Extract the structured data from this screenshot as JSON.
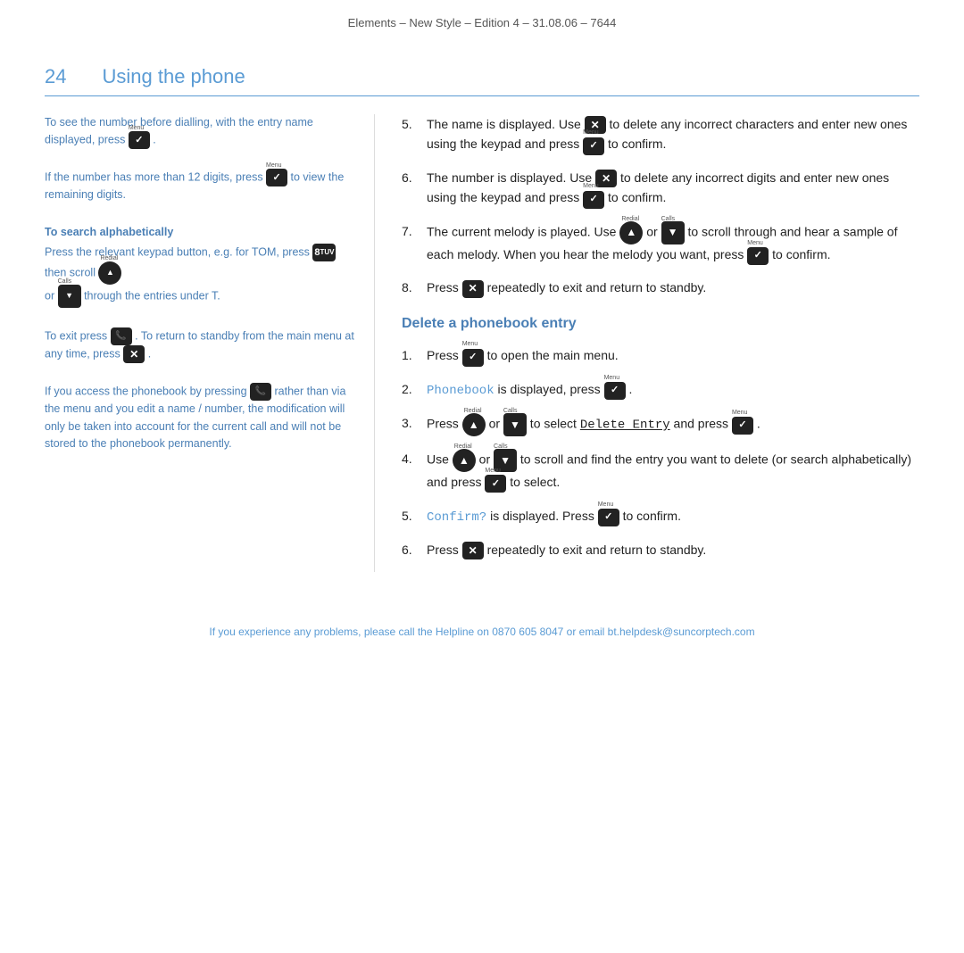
{
  "header": {
    "text": "Elements – New Style – Edition 4 – 31.08.06 – 7644"
  },
  "section": {
    "number": "24",
    "title": "Using the phone"
  },
  "left_column": {
    "block1": {
      "text": "To see the number before dialling, with the entry name displayed, press"
    },
    "block2": {
      "text": "If the number has more than 12 digits, press",
      "text2": "to view the remaining digits."
    },
    "block3": {
      "heading": "To search alphabetically",
      "text": "Press the relevant keypad button, e.g. for TOM, press",
      "text2": "then scroll",
      "text3": "or",
      "text4": "through the entries under T."
    },
    "block4": {
      "text": "To exit press",
      "text2": ". To return to standby from the main menu at any time, press"
    },
    "block5": {
      "text": "If you access the phonebook by pressing",
      "text2": "rather than via the menu and you edit a name / number, the modification will only be taken into account for the current call and will not be stored to the phonebook permanently."
    }
  },
  "right_column": {
    "items": [
      {
        "num": "5.",
        "text_before": "The name is displayed. Use",
        "text_middle": "to delete any incorrect characters and enter new ones using the keypad and press",
        "text_after": "to confirm."
      },
      {
        "num": "6.",
        "text_before": "The number is displayed. Use",
        "text_middle": "to delete any incorrect digits and enter new ones using the keypad and press",
        "text_after": "to confirm."
      },
      {
        "num": "7.",
        "text_before": "The current melody is played. Use",
        "text_middle": "or",
        "text_after": "to scroll through and hear a sample of each melody. When you hear the melody you want, press",
        "text_end": "to confirm."
      },
      {
        "num": "8.",
        "text_before": "Press",
        "text_after": "repeatedly to exit and return to standby."
      }
    ],
    "delete_section": {
      "heading": "Delete a phonebook entry",
      "items": [
        {
          "num": "1.",
          "text": "Press",
          "text2": "to open the main menu."
        },
        {
          "num": "2.",
          "text_before": "",
          "phonebook": "Phonebook",
          "text": "is displayed, press",
          "text2": "."
        },
        {
          "num": "3.",
          "text": "Press",
          "text2": "or",
          "text3": "to select",
          "delete_entry": "Delete Entry",
          "text4": "and press",
          "text5": "."
        },
        {
          "num": "4.",
          "text": "Use",
          "text2": "or",
          "text3": "to scroll and find the entry you want to delete (or search alphabetically) and press",
          "text4": "to select."
        },
        {
          "num": "5.",
          "confirm": "Confirm?",
          "text": "is displayed. Press",
          "text2": "to confirm."
        },
        {
          "num": "6.",
          "text": "Press",
          "text2": "repeatedly to exit and return to standby."
        }
      ]
    }
  },
  "footer": {
    "text": "If you experience any problems, please call the Helpline on 0870 605 8047 or email bt.helpdesk@suncorptech.com"
  }
}
